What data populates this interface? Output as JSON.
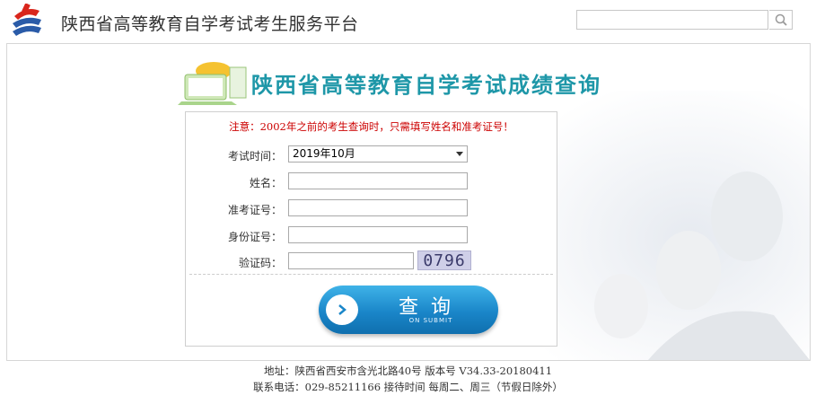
{
  "header": {
    "site_title": "陕西省高等教育自学考试考生服务平台",
    "search_placeholder": "",
    "logo_icon": "exam-logo-icon",
    "search_icon": "search-icon"
  },
  "main": {
    "title": "陕西省高等教育自学考试成绩查询",
    "notice": "注意：2002年之前的考生查询时，只需填写姓名和准考证号！",
    "form": {
      "exam_time_label": "考试时间：",
      "exam_time_value": "2019年10月",
      "name_label": "姓名：",
      "ticket_label": "准考证号：",
      "idcard_label": "身份证号：",
      "captcha_label": "验证码：",
      "captcha_text": "0796"
    },
    "submit": {
      "label": "查询",
      "sub_label": "ON SUBMIT"
    }
  },
  "footer": {
    "address": "地址：陕西省西安市含光北路40号   版本号  V34.33-20180411",
    "contact": "联系电话：029-85211166  接待时间  每周二、周三（节假日除外）"
  },
  "colors": {
    "title": "#1e97a8",
    "notice": "#cc0000",
    "button": "#1a86c9"
  }
}
